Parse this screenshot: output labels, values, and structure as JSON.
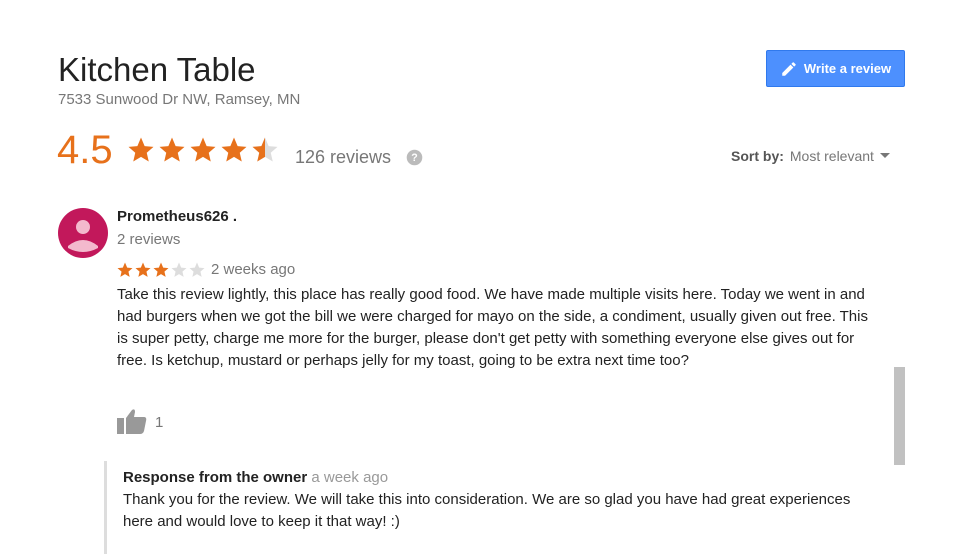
{
  "place": {
    "name": "Kitchen Table",
    "address": "7533 Sunwood Dr NW, Ramsey, MN"
  },
  "actions": {
    "write_review_label": "Write a review",
    "icon": "pencil-icon",
    "button_color": "#4d90fe"
  },
  "summary": {
    "rating": "4.5",
    "rating_value": 4.5,
    "reviews_label": "126 reviews",
    "star_color": "#e7711b"
  },
  "sort": {
    "label": "Sort by:",
    "value": "Most relevant"
  },
  "review": {
    "author": "Prometheus626 .",
    "author_reviews": "2 reviews",
    "stars": 3,
    "time": "2 weeks ago",
    "text": "Take this review lightly, this place has really good food. We have made multiple visits here. Today we went in and had burgers when we got the bill we were charged for mayo on the side, a condiment, usually given out free. This is super petty, charge me more for the burger, please don't get petty with something everyone else gives out for free. Is ketchup, mustard or perhaps jelly for my toast, going to be extra next time too?",
    "likes": "1",
    "avatar_color": "#c2185b"
  },
  "owner_response": {
    "label": "Response from the owner",
    "time": "a week ago",
    "text": "Thank you for the review. We will take this into consideration. We are so glad you have had great experiences here and would love to keep it that way! :)"
  }
}
